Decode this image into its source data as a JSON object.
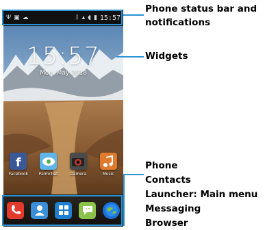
{
  "status_bar": {
    "time": "15:57",
    "left_icons": [
      "usb-icon",
      "image-icon",
      "cloud-icon"
    ],
    "right_icons": [
      "bluetooth-icon",
      "signal-icon",
      "wifi-icon",
      "battery-icon"
    ]
  },
  "widget": {
    "time": "15:57",
    "date": "Mon, May 2018"
  },
  "apps": [
    {
      "label": "Facebook",
      "icon": "facebook-icon",
      "color": "#3b5998"
    },
    {
      "label": "Palmchat",
      "icon": "palmchat-icon",
      "color": "#5fb4e8"
    },
    {
      "label": "Camera",
      "icon": "camera-icon",
      "color": "#4a4a4a"
    },
    {
      "label": "Music",
      "icon": "music-icon",
      "color": "#e07a2e"
    }
  ],
  "dock": [
    {
      "icon": "phone-icon",
      "color": "#e23b2e"
    },
    {
      "icon": "contacts-icon",
      "color": "#3a8fd8"
    },
    {
      "icon": "main-menu-icon",
      "color": "#1e7fd0"
    },
    {
      "icon": "messaging-icon",
      "color": "#8bc34a"
    },
    {
      "icon": "browser-icon",
      "color": "#1d6fd6"
    }
  ],
  "callouts": {
    "status_bar": "Phone status bar and notifications",
    "widgets": "Widgets",
    "dock": [
      "Phone",
      "Contacts",
      "Launcher: Main menu",
      "Messaging",
      "Browser"
    ]
  },
  "accent_color": "#2a93d5"
}
